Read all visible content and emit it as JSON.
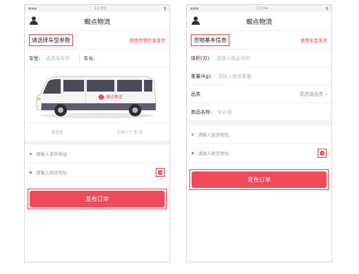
{
  "left": {
    "status_time": "12:03",
    "app_title": "蜘点物流",
    "section_title": "请选择车型参数",
    "section_link": "使用货物信息发货",
    "vehicle_type_label": "车型:",
    "vehicle_type_placeholder": "请选择车型",
    "vehicle_length_label": "车长:",
    "van_brand": "蜘点物流",
    "caption_left": "载重量",
    "caption_right": "车厢尺寸\"宽\"高",
    "from_address_placeholder": "请输入发货地址",
    "to_address_placeholder": "请输入收货地址",
    "submit_label": "发布订单"
  },
  "right": {
    "status_time": "12:04",
    "app_title": "蜘点物流",
    "section_title": "货物基本信息",
    "section_link": "使用车型发货",
    "volume_label": "体积(方):",
    "volume_placeholder": "请输入商品体积",
    "weight_label": "重量(Kg):",
    "weight_placeholder": "请输入商品重量",
    "category_label": "品类",
    "category_value": "请选择品类",
    "goods_name_label": "商品名称:",
    "goods_name_placeholder": "非必填",
    "from_address_placeholder": "请输入发货地址",
    "to_address_placeholder": "请输入收货地址",
    "submit_label": "发布订单"
  },
  "colors": {
    "accent": "#f04a5b",
    "highlight_border": "#e03b48",
    "from_dot": "#3cb870",
    "to_dot": "#e8403e"
  }
}
